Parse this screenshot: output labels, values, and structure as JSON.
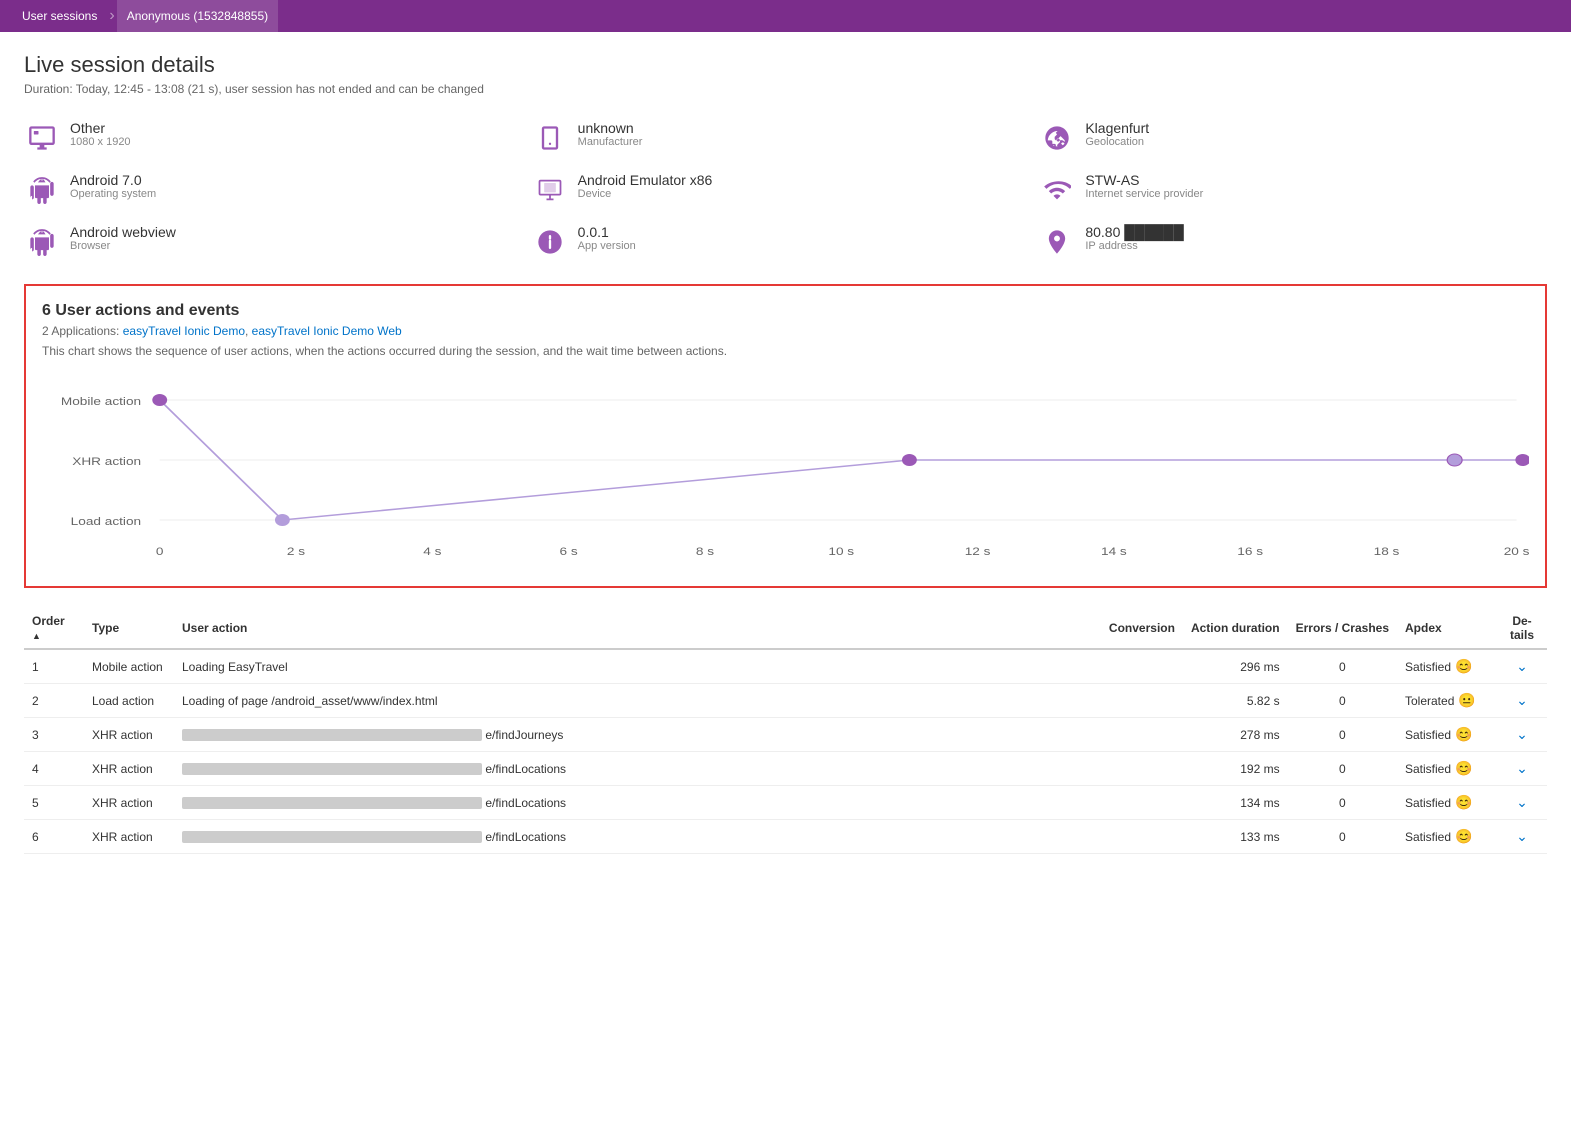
{
  "nav": {
    "items": [
      {
        "label": "User sessions",
        "active": false
      },
      {
        "label": "Anonymous (1532848855)",
        "active": true
      }
    ]
  },
  "page": {
    "title": "Live session details",
    "subtitle": "Duration: Today, 12:45 - 13:08 (21 s), user session has not ended and can be changed"
  },
  "device_info": [
    {
      "icon": "monitor",
      "label": "Other",
      "sub": "1080 x 1920"
    },
    {
      "icon": "phone",
      "label": "unknown Manufacturer",
      "sub": ""
    },
    {
      "icon": "globe",
      "label": "Klagenfurt",
      "sub": "Geolocation"
    },
    {
      "icon": "android",
      "label": "Android 7.0",
      "sub": "Operating system"
    },
    {
      "icon": "device",
      "label": "Android Emulator x86",
      "sub": "Device"
    },
    {
      "icon": "wifi",
      "label": "STW-AS",
      "sub": "Internet service provider"
    },
    {
      "icon": "android",
      "label": "Android webview",
      "sub": "Browser"
    },
    {
      "icon": "info",
      "label": "0.0.1",
      "sub": "App version"
    },
    {
      "icon": "location",
      "label": "80.80.███████",
      "sub": "IP address"
    }
  ],
  "chart": {
    "title": "6 User actions and events",
    "apps_label": "2 Applications:",
    "apps": [
      {
        "label": "easyTravel Ionic Demo",
        "href": "#"
      },
      {
        "label": "easyTravel Ionic Demo Web",
        "href": "#"
      }
    ],
    "description": "This chart shows the sequence of user actions, when the actions occurred during the session, and the wait time between actions.",
    "y_labels": [
      "Mobile action",
      "XHR action",
      "Load action"
    ],
    "x_labels": [
      "0",
      "2 s",
      "4 s",
      "6 s",
      "8 s",
      "10 s",
      "12 s",
      "14 s",
      "16 s",
      "18 s",
      "20 s"
    ]
  },
  "table": {
    "headers": [
      {
        "label": "Order",
        "sub": "▲",
        "col": "order"
      },
      {
        "label": "Type",
        "col": "type"
      },
      {
        "label": "User action",
        "col": "action"
      },
      {
        "label": "Conversion",
        "col": "conversion"
      },
      {
        "label": "Action duration",
        "col": "duration"
      },
      {
        "label": "Errors / Crashes",
        "col": "errors"
      },
      {
        "label": "Apdex",
        "col": "apdex"
      },
      {
        "label": "De-\ntails",
        "col": "details"
      }
    ],
    "rows": [
      {
        "order": "1",
        "type": "Mobile action",
        "action": "Loading EasyTravel",
        "action_redacted": false,
        "conversion": "",
        "duration": "296 ms",
        "errors": "0",
        "apdex": "Satisfied",
        "apdex_icon": "😊"
      },
      {
        "order": "2",
        "type": "Load action",
        "action": "Loading of page /android_asset/www/index.html",
        "action_redacted": false,
        "conversion": "",
        "duration": "5.82 s",
        "errors": "0",
        "apdex": "Tolerated",
        "apdex_icon": "😐"
      },
      {
        "order": "3",
        "type": "XHR action",
        "action": "e/findJourneys",
        "action_redacted": true,
        "conversion": "",
        "duration": "278 ms",
        "errors": "0",
        "apdex": "Satisfied",
        "apdex_icon": "😊"
      },
      {
        "order": "4",
        "type": "XHR action",
        "action": "e/findLocations",
        "action_redacted": true,
        "conversion": "",
        "duration": "192 ms",
        "errors": "0",
        "apdex": "Satisfied",
        "apdex_icon": "😊"
      },
      {
        "order": "5",
        "type": "XHR action",
        "action": "e/findLocations",
        "action_redacted": true,
        "conversion": "",
        "duration": "134 ms",
        "errors": "0",
        "apdex": "Satisfied",
        "apdex_icon": "😊"
      },
      {
        "order": "6",
        "type": "XHR action",
        "action": "e/findLocations",
        "action_redacted": true,
        "conversion": "",
        "duration": "133 ms",
        "errors": "0",
        "apdex": "Satisfied",
        "apdex_icon": "😊"
      }
    ]
  }
}
